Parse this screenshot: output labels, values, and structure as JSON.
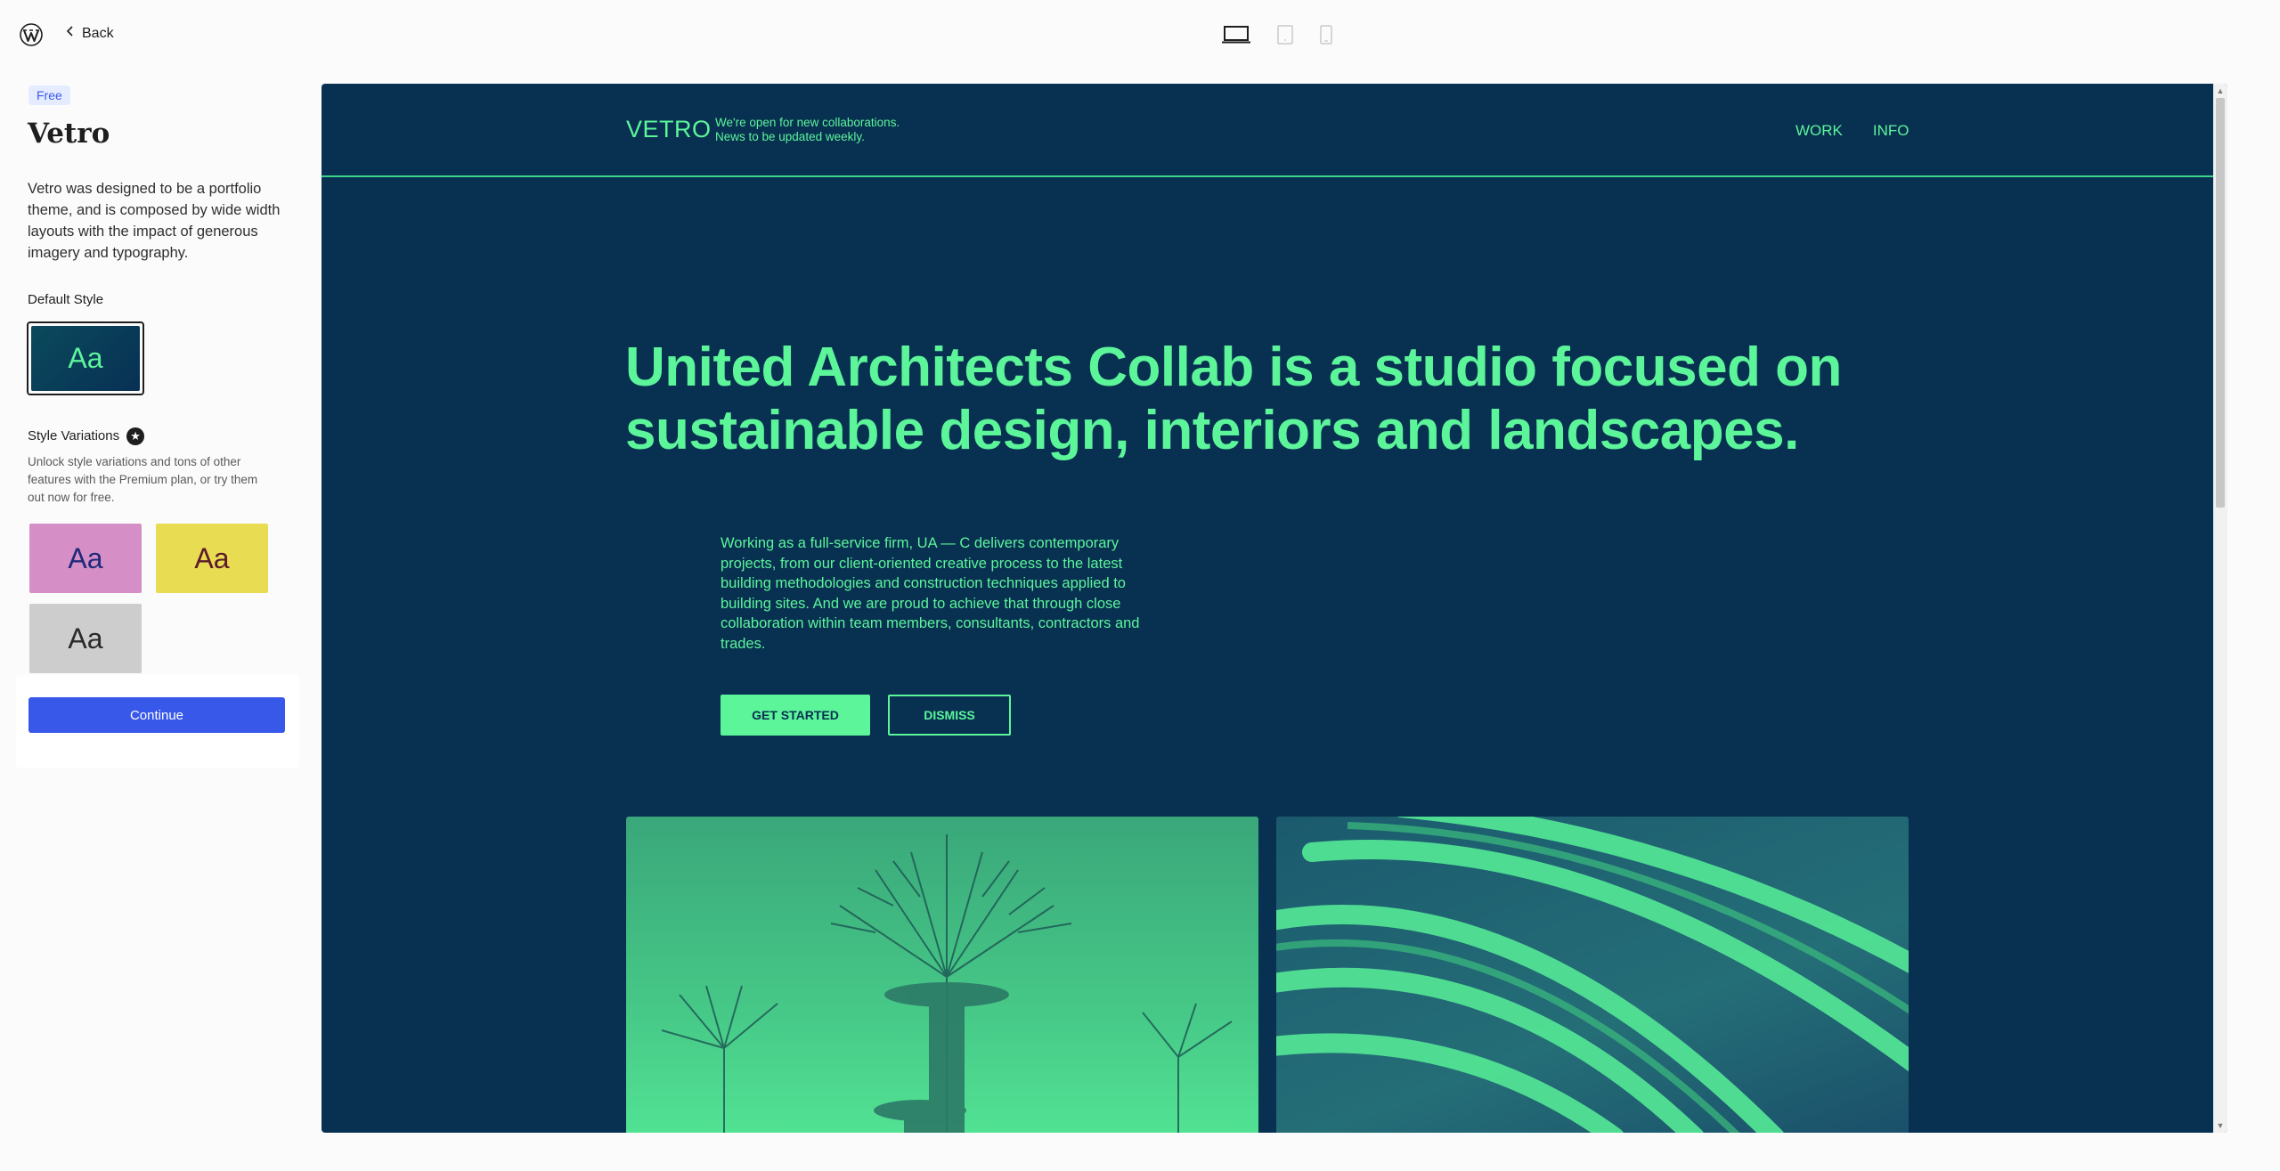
{
  "topbar": {
    "back_label": "Back"
  },
  "sidebar": {
    "badge": "Free",
    "theme_name": "Vetro",
    "description": "Vetro was designed to be a portfolio theme, and is composed by wide width layouts with the impact of generous imagery and typography.",
    "default_style_label": "Default Style",
    "default_swatch_text": "Aa",
    "variations_label": "Style Variations",
    "variations_note": "Unlock style variations and tons of other features with the Premium plan, or try them out now for free.",
    "variations": [
      {
        "text": "Aa",
        "bg": "#d58fc6",
        "fg": "#1e2a7a"
      },
      {
        "text": "Aa",
        "bg": "#e8dc52",
        "fg": "#5a1a2a"
      },
      {
        "text": "Aa",
        "bg": "#cdcdcd",
        "fg": "#2a2a2a"
      }
    ],
    "continue_label": "Continue"
  },
  "preview": {
    "brand": "VETRO",
    "tagline_line1": "We're open for new collaborations.",
    "tagline_line2": "News to be updated weekly.",
    "nav": [
      "WORK",
      "INFO"
    ],
    "hero_line1": "United Architects Collab is a studio focused on",
    "hero_line2": "sustainable design, interiors and landscapes.",
    "body": "Working as a full-service firm, UA — C delivers contemporary projects, from our client-oriented creative process to the latest building methodologies and construction techniques applied to building sites. And we are proud to achieve that through close collaboration within team members, consultants, contractors and trades.",
    "cta_label": "GET STARTED",
    "dismiss_label": "DISMISS"
  },
  "colors": {
    "accent": "#3858e9",
    "preview_bg": "#083051",
    "preview_fg": "#5cf59a"
  },
  "icons": {
    "logo": "wordpress-logo-icon",
    "back": "chevron-left-icon",
    "devices": [
      "desktop-icon",
      "tablet-icon",
      "mobile-icon"
    ],
    "variations_star": "star-icon"
  }
}
